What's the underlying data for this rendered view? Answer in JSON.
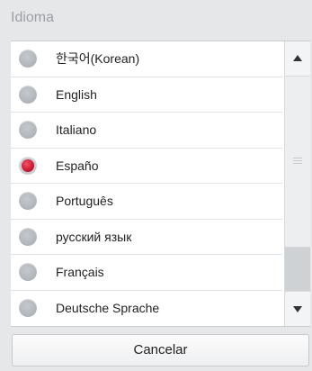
{
  "dialog": {
    "title": "Idioma",
    "cancel_label": "Cancelar"
  },
  "languages": [
    {
      "label": "한국어(Korean)",
      "selected": false
    },
    {
      "label": "English",
      "selected": false
    },
    {
      "label": "Italiano",
      "selected": false
    },
    {
      "label": "Españo",
      "selected": true
    },
    {
      "label": "Português",
      "selected": false
    },
    {
      "label": "русский язык",
      "selected": false
    },
    {
      "label": "Français",
      "selected": false
    },
    {
      "label": "Deutsche Sprache",
      "selected": false
    }
  ],
  "icons": {
    "scroll_up": "triangle-up-icon",
    "scroll_down": "triangle-down-icon"
  },
  "colors": {
    "selected_radio": "#d11a33",
    "unselected_radio": "#b2b7bd"
  }
}
